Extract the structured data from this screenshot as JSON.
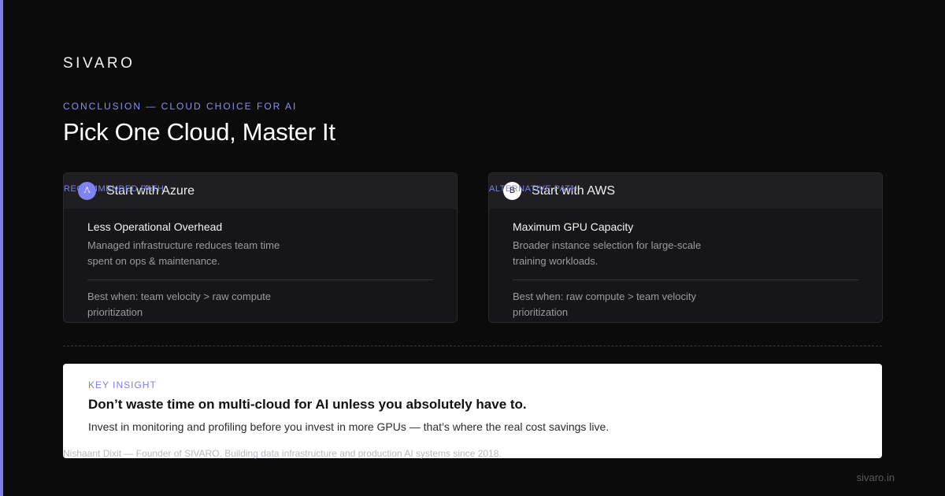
{
  "brand": "SIVARO",
  "eyebrow": "CONCLUSION — CLOUD CHOICE FOR AI",
  "title": "Pick One Cloud, Master It",
  "colors": {
    "background": "#0b0b0c",
    "accent": "#7c7fe8",
    "card": "#161618",
    "insight_card": "#ffffff"
  },
  "cards": [
    {
      "tag": "RECOMMENDED PATH",
      "badge": "A",
      "name": "Start with Azure",
      "heading": "Less Operational Overhead",
      "description": "Managed infrastructure reduces team time spent on ops & maintenance.",
      "best_when": "Best when: team velocity > raw compute prioritization"
    },
    {
      "tag": "ALTERNATIVE PATH",
      "badge": "B",
      "name": "Start with AWS",
      "heading": "Maximum GPU Capacity",
      "description": "Broader instance selection for large-scale training workloads.",
      "best_when": "Best when: raw compute > team velocity prioritization"
    }
  ],
  "insight": {
    "label": "KEY INSIGHT",
    "headline": "Don’t waste time on multi-cloud for AI unless you absolutely have to.",
    "body": "Invest in monitoring and profiling before you invest in more GPUs — that’s where the real cost savings live."
  },
  "author": "Nishaant Dixit — Founder of SIVARO. Building data infrastructure and production AI systems since 2018.",
  "site": "sivaro.in"
}
